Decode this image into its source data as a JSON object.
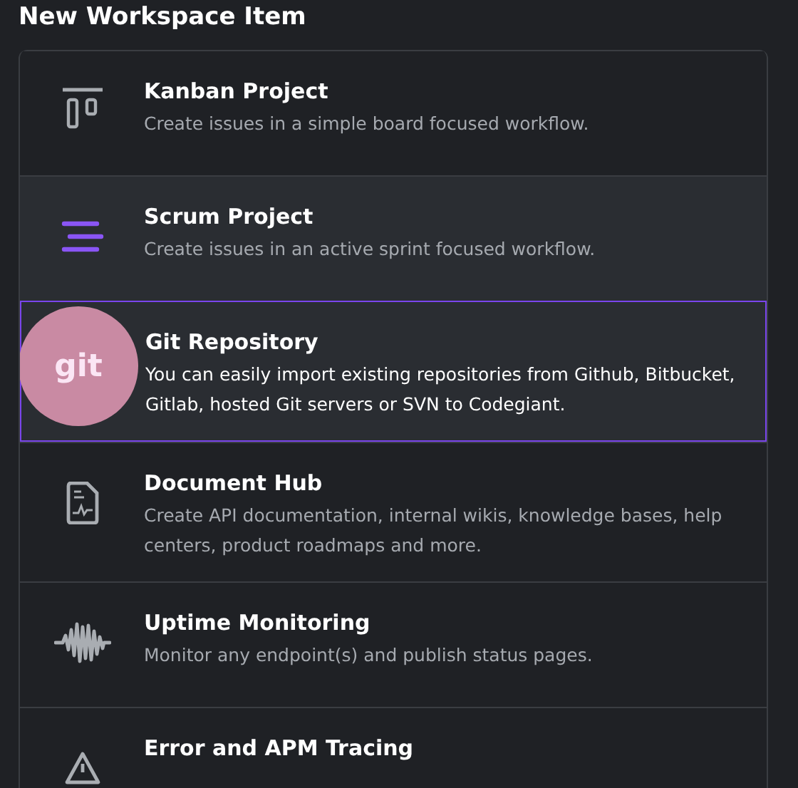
{
  "title": "New Workspace Item",
  "items": [
    {
      "kind": "kanban",
      "title": "Kanban Project",
      "description": "Create issues in a simple board focused workflow.",
      "hovered": false,
      "selected": false
    },
    {
      "kind": "scrum",
      "title": "Scrum Project",
      "description": "Create issues in an active sprint focused workflow.",
      "hovered": true,
      "selected": false
    },
    {
      "kind": "git",
      "badge": "git",
      "title": "Git Repository",
      "description": "You can easily import existing repositories from Github, Bitbucket, Gitlab, hosted Git servers or SVN to Codegiant.",
      "hovered": false,
      "selected": true
    },
    {
      "kind": "document",
      "title": "Document Hub",
      "description": "Create API documentation, internal wikis, knowledge bases, help centers, product roadmaps and more.",
      "hovered": false,
      "selected": false
    },
    {
      "kind": "waveform",
      "title": "Uptime Monitoring",
      "description": "Monitor any endpoint(s) and publish status pages.",
      "hovered": false,
      "selected": false
    },
    {
      "kind": "warning",
      "title": "Error and APM Tracing",
      "hovered": false,
      "selected": false
    }
  ]
}
